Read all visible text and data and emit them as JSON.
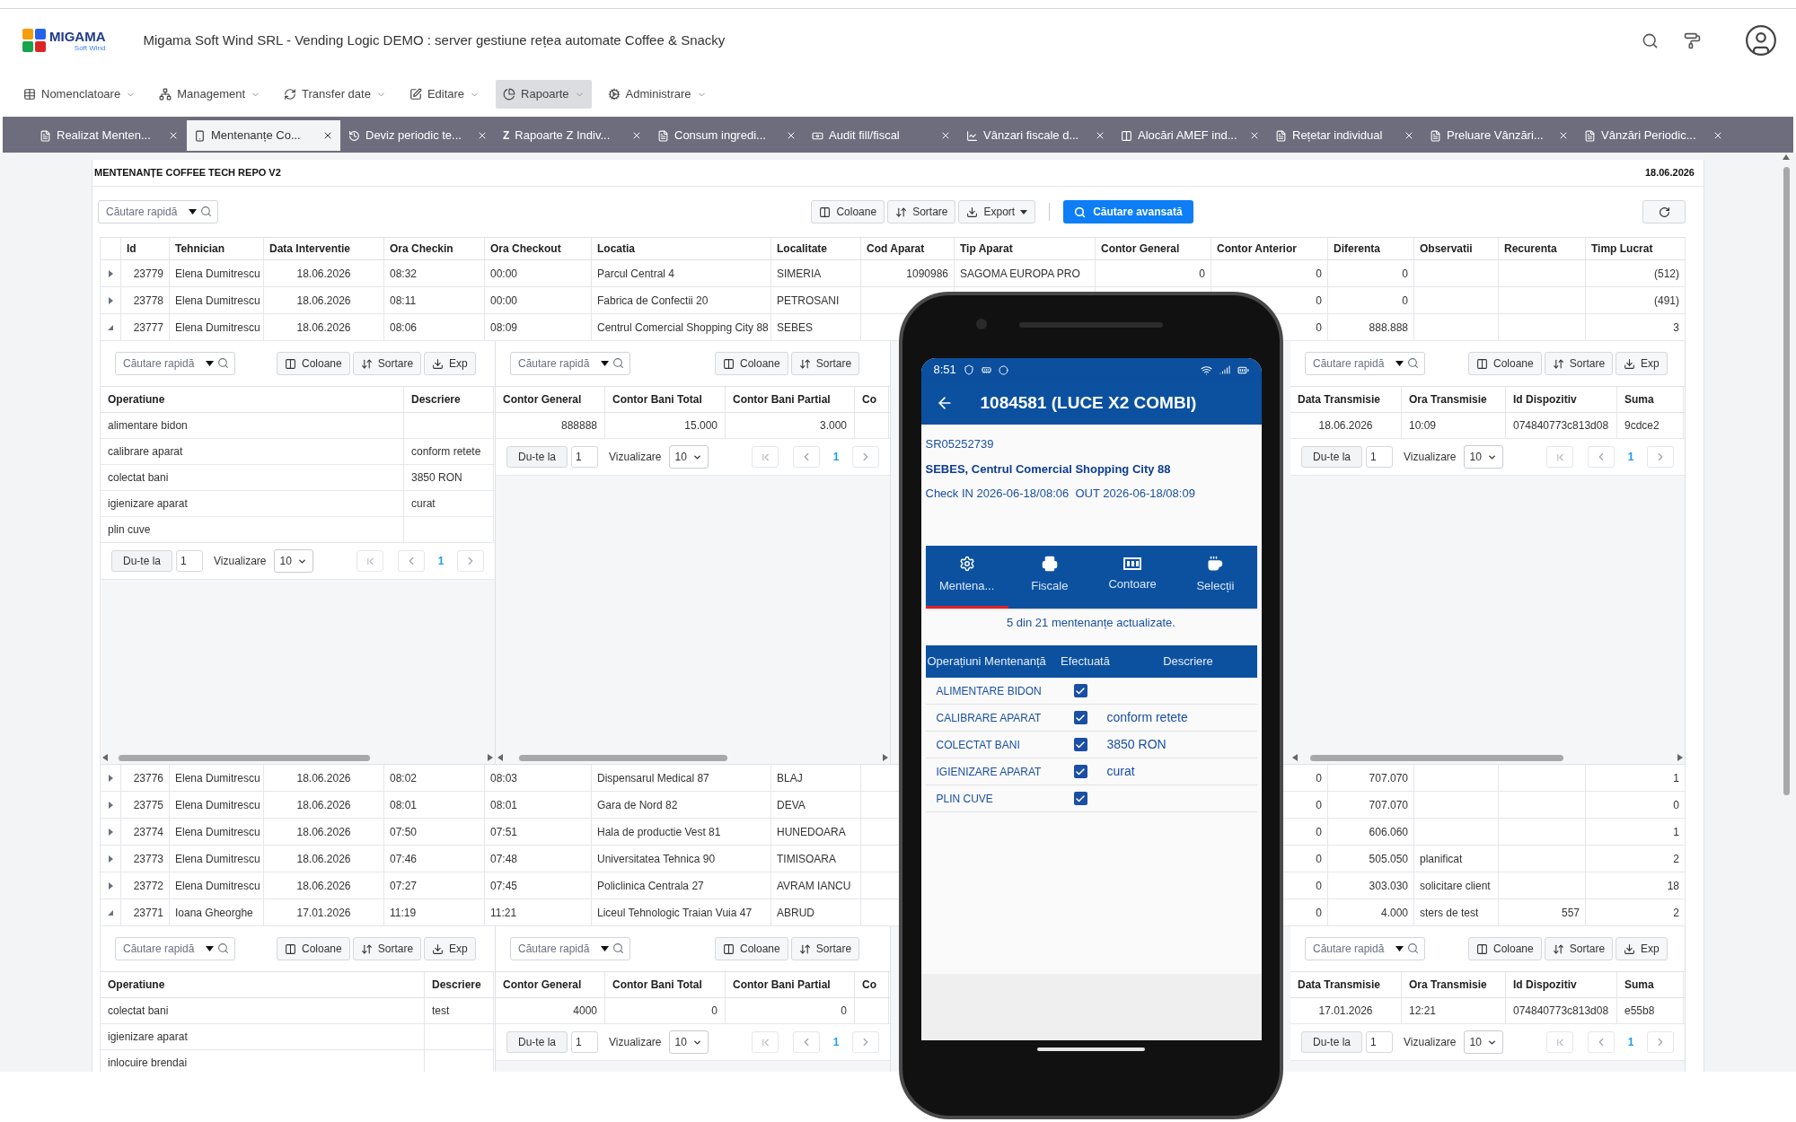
{
  "header": {
    "logo_text": "MIGAMA",
    "logo_subtext": "Soft Wind",
    "title": "Migama Soft Wind SRL - Vending Logic DEMO : server gestiune rețea automate Coffee & Snacky"
  },
  "menu": [
    {
      "label": "Nomenclatoare",
      "selected": false
    },
    {
      "label": "Management",
      "selected": false
    },
    {
      "label": "Transfer date",
      "selected": false
    },
    {
      "label": "Editare",
      "selected": false
    },
    {
      "label": "Rapoarte",
      "selected": true
    },
    {
      "label": "Administrare",
      "selected": false
    }
  ],
  "tabs": [
    {
      "label": "Realizat Menten...",
      "selected": false
    },
    {
      "label": "Mentenanțe Co...",
      "selected": true
    },
    {
      "label": "Deviz periodic te...",
      "selected": false
    },
    {
      "label": "Rapoarte Z Indiv...",
      "glyph": "Z",
      "selected": false
    },
    {
      "label": "Consum ingredi...",
      "selected": false
    },
    {
      "label": "Audit fill/fiscal",
      "selected": false
    },
    {
      "label": "Vânzari fiscale d...",
      "selected": false
    },
    {
      "label": "Alocări AMEF ind...",
      "selected": false
    },
    {
      "label": "Rețetar individual",
      "selected": false
    },
    {
      "label": "Preluare Vânzări...",
      "selected": false
    },
    {
      "label": "Vânzări Periodic...",
      "selected": false
    }
  ],
  "report": {
    "title": "MENTENANȚE COFFEE TECH REPO V2",
    "date": "18.06.2026",
    "search_placeholder": "Căutare rapidă",
    "buttons": [
      "Coloane",
      "Sortare",
      "Export"
    ],
    "advanced_search": "Căutare avansată"
  },
  "table": {
    "columns": [
      "Id",
      "Tehnician",
      "Data Interventie",
      "Ora Checkin",
      "Ora Checkout",
      "Locatia",
      "Localitate",
      "Cod Aparat",
      "Tip Aparat",
      "Contor General",
      "Contor Anterior",
      "Diferenta",
      "Observatii",
      "Recurenta",
      "Timp Lucrat"
    ],
    "rows": [
      {
        "expanded": false,
        "cells": [
          "23779",
          "Elena Dumitrescu",
          "18.06.2026",
          "08:32",
          "00:00",
          "Parcul Central 4",
          "SIMERIA",
          "1090986",
          "SAGOMA EUROPA PRO",
          "0",
          "0",
          "0",
          null,
          null,
          "(512)"
        ]
      },
      {
        "expanded": false,
        "cells": [
          "23778",
          "Elena Dumitrescu",
          "18.06.2026",
          "08:11",
          "00:00",
          "Fabrica de Confectii 20",
          "PETROSANI",
          null,
          null,
          null,
          "0",
          "0",
          null,
          null,
          "(491)"
        ]
      },
      {
        "expanded": true,
        "cells": [
          "23777",
          "Elena Dumitrescu",
          "18.06.2026",
          "08:06",
          "08:09",
          "Centrul Comercial Shopping City 88",
          "SEBES",
          null,
          null,
          null,
          "0",
          "888.888",
          null,
          null,
          "3"
        ],
        "details": [
          {
            "search_placeholder": "Căutare rapidă",
            "buttons": [
              "Coloane",
              "Sortare",
              "Exp"
            ],
            "columns": [
              "Operatiune",
              "Descriere"
            ],
            "rows": [
              [
                "alimentare bidon",
                null
              ],
              [
                "calibrare aparat",
                "conform retete"
              ],
              [
                "colectat bani",
                "3850 RON"
              ],
              [
                "igienizare aparat",
                "curat"
              ],
              [
                "plin cuve",
                null
              ]
            ],
            "pagination": {
              "goto": "Du-te la",
              "page_input": "1",
              "view_label": "Vizualizare",
              "page_size": "10",
              "page": "1"
            }
          },
          {
            "search_placeholder": "Căutare rapidă",
            "buttons": [
              "Coloane",
              "Sortare"
            ],
            "columns": [
              "Contor General",
              "Contor Bani Total",
              "Contor Bani Partial",
              "Co"
            ],
            "rows": [
              [
                "888888",
                "15.000",
                "3.000",
                null
              ]
            ],
            "pagination": {
              "goto": "Du-te la",
              "page_input": "1",
              "view_label": "Vizualizare",
              "page_size": "10",
              "page": "1"
            }
          },
          {
            "search_placeholder": "Căutare rapidă",
            "buttons": [
              "Coloane",
              "Sortare",
              "Exp"
            ],
            "columns": [
              "Data Transmisie",
              "Ora Transmisie",
              "Id Dispozitiv",
              "Suma"
            ],
            "rows": [
              [
                "18.06.2026",
                "10:09",
                "074840773c813d08",
                "9cdce2"
              ]
            ],
            "pagination": {
              "goto": "Du-te la",
              "page_input": "1",
              "view_label": "Vizualizare",
              "page_size": "10",
              "page": "1"
            }
          }
        ]
      },
      {
        "expanded": false,
        "cells": [
          "23776",
          "Elena Dumitrescu",
          "18.06.2026",
          "08:02",
          "08:03",
          "Dispensarul Medical 87",
          "BLAJ",
          null,
          null,
          null,
          "0",
          "707.070",
          null,
          null,
          "1"
        ]
      },
      {
        "expanded": false,
        "cells": [
          "23775",
          "Elena Dumitrescu",
          "18.06.2026",
          "08:01",
          "08:01",
          "Gara de Nord 82",
          "DEVA",
          null,
          null,
          null,
          "0",
          "707.070",
          null,
          null,
          "0"
        ]
      },
      {
        "expanded": false,
        "cells": [
          "23774",
          "Elena Dumitrescu",
          "18.06.2026",
          "07:50",
          "07:51",
          "Hala de productie Vest 81",
          "HUNEDOARA",
          null,
          null,
          null,
          "0",
          "606.060",
          null,
          null,
          "1"
        ]
      },
      {
        "expanded": false,
        "cells": [
          "23773",
          "Elena Dumitrescu",
          "18.06.2026",
          "07:46",
          "07:48",
          "Universitatea Tehnica 90",
          "TIMISOARA",
          null,
          null,
          null,
          "0",
          "505.050",
          "planificat",
          null,
          "2"
        ]
      },
      {
        "expanded": false,
        "cells": [
          "23772",
          "Elena Dumitrescu",
          "18.06.2026",
          "07:27",
          "07:45",
          "Policlinica Centrala 27",
          "AVRAM IANCU",
          null,
          null,
          null,
          "0",
          "303.030",
          "solicitare client",
          null,
          "18"
        ]
      },
      {
        "expanded": true,
        "cells": [
          "23771",
          "Ioana Gheorghe",
          "17.01.2026",
          "11:19",
          "11:21",
          "Liceul Tehnologic Traian Vuia 47",
          "ABRUD",
          null,
          null,
          null,
          "0",
          "4.000",
          "sters de test",
          "557",
          "2"
        ],
        "details": [
          {
            "search_placeholder": "Căutare rapidă",
            "buttons": [
              "Coloane",
              "Sortare",
              "Exp"
            ],
            "columns": [
              "Operatiune",
              "Descriere"
            ],
            "rows": [
              [
                "colectat bani",
                "test"
              ],
              [
                "igienizare aparat",
                null
              ],
              [
                "inlocuire brendai",
                null
              ]
            ]
          },
          {
            "search_placeholder": "Căutare rapidă",
            "buttons": [
              "Coloane",
              "Sortare"
            ],
            "columns": [
              "Contor General",
              "Contor Bani Total",
              "Contor Bani Partial",
              "Co"
            ],
            "rows": [
              [
                "4000",
                "0",
                "0",
                null
              ]
            ],
            "pagination": {
              "goto": "Du-te la",
              "page_input": "1",
              "view_label": "Vizualizare",
              "page_size": "10",
              "page": "1"
            }
          },
          {
            "search_placeholder": "Căutare rapidă",
            "buttons": [
              "Coloane",
              "Sortare",
              "Exp"
            ],
            "columns": [
              "Data Transmisie",
              "Ora Transmisie",
              "Id Dispozitiv",
              "Suma"
            ],
            "rows": [
              [
                "17.01.2026",
                "12:21",
                "074840773c813d08",
                "e55b8"
              ]
            ],
            "pagination": {
              "goto": "Du-te la",
              "page_input": "1",
              "view_label": "Vizualizare",
              "page_size": "10",
              "page": "1"
            }
          }
        ]
      }
    ]
  },
  "phone": {
    "time": "8:51",
    "title": "1084581 (LUCE X2 COMBI)",
    "serial": "SR05252739",
    "location": "SEBES, Centrul Comercial Shopping City 88",
    "check": "Check IN 2026-06-18/08:06  OUT 2026-06-18/08:09",
    "tabs": [
      {
        "label": "Mentena...",
        "selected": true
      },
      {
        "label": "Fiscale",
        "selected": false
      },
      {
        "label": "Contoare",
        "selected": false
      },
      {
        "label": "Selecții",
        "selected": false
      }
    ],
    "status_message": "5 din 21 mentenanțe actualizate.",
    "columns": [
      "Operațiuni Mentenanță",
      "Efectuată",
      "Descriere"
    ],
    "rows": [
      {
        "operation": "ALIMENTARE BIDON",
        "checked": true
      },
      {
        "operation": "CALIBRARE APARAT",
        "checked": true,
        "description": "conform retete"
      },
      {
        "operation": "COLECTAT BANI",
        "checked": true,
        "description": "3850 RON"
      },
      {
        "operation": "IGIENIZARE APARAT",
        "checked": true,
        "description": "curat"
      },
      {
        "operation": "PLIN CUVE",
        "checked": true
      }
    ]
  }
}
